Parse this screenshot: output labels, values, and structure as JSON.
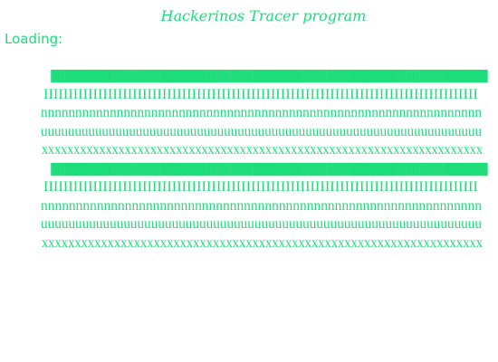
{
  "window": {
    "title": "Hackerinos Tracer program"
  },
  "status": {
    "label": "Loading:"
  },
  "lines": [
    {
      "kind": "bar",
      "text": "||||||||||||||||||||||||||||||||||||||||||||||||||||||||||||||||||||||||||||||||||||||||||||||||||||||||||||||||||||||||||||||||||||||||||||||||||||||||||||||||||||||||||||||||||||||||||||||||"
    },
    {
      "kind": "i",
      "text": "IIIIIIIIIIIIIIIIIIIIIIIIIIIIIIIIIIIIIIIIIIIIIIIIIIIIIIIIIIIIIIIIIIIIIIIIIIIIIIIIIIIIIIII"
    },
    {
      "kind": "n",
      "text": "nnnnnnnnnnnnnnnnnnnnnnnnnnnnnnnnnnnnnnnnnnnnnnnnnnnnnnnnnnnnnnnn"
    },
    {
      "kind": "u",
      "text": "uuuuuuuuuuuuuuuuuuuuuuuuuuuuuuuuuuuuuuuuuuuuuuuuuuuuuuuuuuuuuuuuu"
    },
    {
      "kind": "x",
      "text": "xxxxxxxxxxxxxxxxxxxxxxxxxxxxxxxxxxxxxxxxxxxxxxxxxxxxxxxxxxxxxxxxxxxxx"
    },
    {
      "kind": "bar",
      "text": "||||||||||||||||||||||||||||||||||||||||||||||||||||||||||||||||||||||||||||||||||||||||||||||||||||||||||||||||||||||||||||||||||||||||||||||||||||||||||||||||||||||||||||||||||||||||||||||||"
    },
    {
      "kind": "i",
      "text": "IIIIIIIIIIIIIIIIIIIIIIIIIIIIIIIIIIIIIIIIIIIIIIIIIIIIIIIIIIIIIIIIIIIIIIIIIIIIIIIIIIIIIIII"
    },
    {
      "kind": "n",
      "text": "nnnnnnnnnnnnnnnnnnnnnnnnnnnnnnnnnnnnnnnnnnnnnnnnnnnnnnnnnnnnnnn"
    },
    {
      "kind": "u",
      "text": "uuuuuuuuuuuuuuuuuuuuuuuuuuuuuuuuuuuuuuuuuuuuuuuuuuuuuuuuuuuuuuuu"
    },
    {
      "kind": "x",
      "text": "xxxxxxxxxxxxxxxxxxxxxxxxxxxxxxxxxxxxxxxxxxxxxxxxxxxxxxxxxxxxxxxxxxx"
    }
  ]
}
